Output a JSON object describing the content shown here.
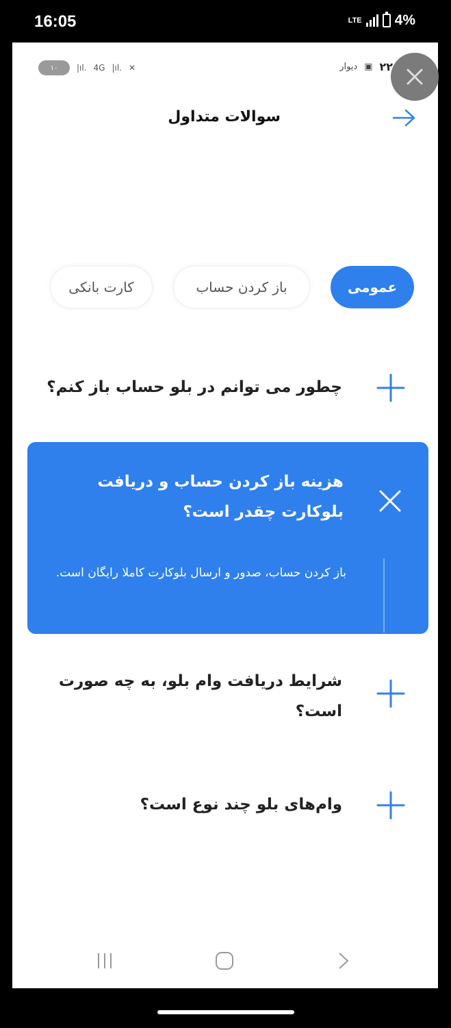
{
  "outer_status": {
    "time": "16:05",
    "network": "LTE",
    "battery": "4%"
  },
  "inner_status": {
    "time": "۲۲:۵۷",
    "label_small": "دیوار",
    "battery_pill": "۱۰",
    "net": "4G"
  },
  "header": {
    "title": "سوالات متداول"
  },
  "tabs": [
    {
      "label": "عمومی",
      "active": true
    },
    {
      "label": "باز کردن حساب",
      "active": false
    },
    {
      "label": "کارت بانکی",
      "active": false
    }
  ],
  "faqs": [
    {
      "question": "چطور می توانم در بلو حساب باز کنم؟"
    },
    {
      "question": "هزینه باز کردن حساب و دریافت بلوکارت چقدر است؟",
      "answer": "باز کردن حساب، صدور و ارسال بلوکارت کاملا رایگان است."
    },
    {
      "question": "شرایط دریافت وام بلو، به چه صورت است؟"
    },
    {
      "question": "وام‌های بلو چند نوع است؟"
    }
  ],
  "colors": {
    "accent": "#2f80ed",
    "background": "#ffffff",
    "text": "#222222"
  },
  "icons": {
    "back": "arrow-right-icon",
    "expand": "plus-icon",
    "collapse": "close-icon"
  }
}
